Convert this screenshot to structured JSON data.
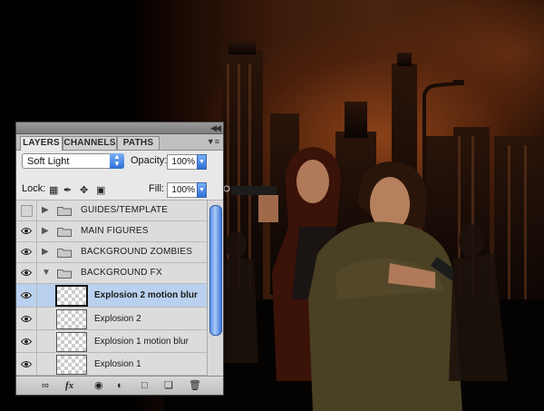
{
  "panel": {
    "tabs": [
      {
        "label": "LAYERS",
        "active": true
      },
      {
        "label": "CHANNELS",
        "active": false
      },
      {
        "label": "PATHS",
        "active": false
      }
    ],
    "blend_mode": "Soft Light",
    "opacity_label": "Opacity:",
    "opacity_value": "100%",
    "lock_label": "Lock:",
    "fill_label": "Fill:",
    "fill_value": "100%",
    "layers": [
      {
        "name": "GUIDES/TEMPLATE",
        "type": "folder",
        "visible": false,
        "expanded": false
      },
      {
        "name": "MAIN FIGURES",
        "type": "folder",
        "visible": true,
        "expanded": false
      },
      {
        "name": "BACKGROUND ZOMBIES",
        "type": "folder",
        "visible": true,
        "expanded": false
      },
      {
        "name": "BACKGROUND FX",
        "type": "folder",
        "visible": true,
        "expanded": true
      },
      {
        "name": "Explosion 2 motion blur",
        "type": "layer",
        "visible": true,
        "selected": true
      },
      {
        "name": "Explosion 2",
        "type": "layer",
        "visible": true
      },
      {
        "name": "Explosion 1 motion blur",
        "type": "layer",
        "visible": true
      },
      {
        "name": "Explosion 1",
        "type": "layer",
        "visible": true
      }
    ],
    "footer_icons": [
      "link-icon",
      "fx-icon",
      "mask-icon",
      "adjustment-icon",
      "new-group-icon",
      "new-layer-icon",
      "trash-icon"
    ]
  },
  "colors": {
    "selection": "#b9d1ee",
    "accent_blue": "#2f6fd6",
    "panel_bg": "#e8e8e8"
  }
}
